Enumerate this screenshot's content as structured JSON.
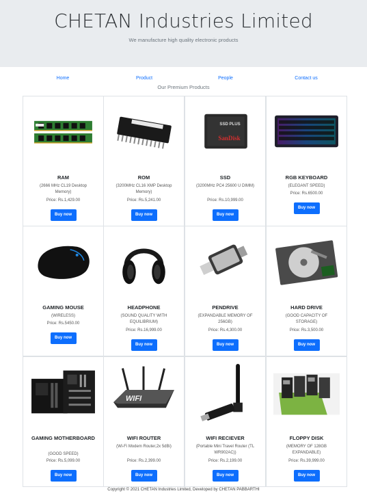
{
  "header": {
    "title": "CHETAN Industries Limited",
    "tagline": "We manufacture high quality electronic products"
  },
  "nav": [
    {
      "label": "Home"
    },
    {
      "label": "Product"
    },
    {
      "label": "People"
    },
    {
      "label": "Contact us"
    }
  ],
  "section_title": "Our Premium Products",
  "products": [
    {
      "name": "RAM",
      "desc": "(2666 MHz CL19 Desktop Memory)",
      "price": "Price: Rs.1,429.00",
      "button": "Buy now",
      "icon": "ram-icon"
    },
    {
      "name": "ROM",
      "desc": "(3200MHz CL16 XMP Desktop Memory)",
      "price": "Price: Rs.5,241.00",
      "button": "Buy now",
      "icon": "rom-chip-icon"
    },
    {
      "name": "SSD",
      "desc": "(3200MHz PC4 25600 U DIMM)",
      "price": "Price: Rs.10,999.00",
      "button": "Buy now",
      "icon": "ssd-icon"
    },
    {
      "name": "RGB KEYBOARD",
      "desc": "(ELEGANT SPEED)",
      "price": "Price: Rs.6500.00",
      "button": "Buy now",
      "icon": "keyboard-icon"
    },
    {
      "name": "GAMING MOUSE",
      "desc": "(WIRELESS)",
      "price": "Price: Rs.5450.00",
      "button": "Buy now",
      "icon": "mouse-icon"
    },
    {
      "name": "HEADPHONE",
      "desc": "(SOUND QUALITY WITH EQUILIBRIUM)",
      "price": "Price: Rs.16,999.00",
      "button": "Buy now",
      "icon": "headphone-icon"
    },
    {
      "name": "PENDRIVE",
      "desc": "(EXPANDABLE MEMORY OF 256GB)",
      "price": "Price: Rs.4,300.00",
      "button": "Buy now",
      "icon": "pendrive-icon"
    },
    {
      "name": "HARD DRIVE",
      "desc": "(GOOD CAPACITY OF STORAGE)",
      "price": "Price: Rs.3,500.00",
      "button": "Buy now",
      "icon": "hard-drive-icon"
    },
    {
      "name": "GAMING MOTHERBOARD",
      "desc": "(GOOD SPEED)",
      "price": "Price: Rs.5,099.00",
      "button": "Buy now",
      "icon": "motherboard-icon"
    },
    {
      "name": "WIFI ROUTER",
      "desc": "(Wi-Fi Modem Router,2x 5dBi)",
      "price": "Price: Rs.2,399.00",
      "button": "Buy now",
      "icon": "router-icon"
    },
    {
      "name": "WIFI RECIEVER",
      "desc": "(Portable Mini Travel Router (TL WR902AC))",
      "price": "Price: Rs.2,199.00",
      "button": "Buy now",
      "icon": "wifi-receiver-icon"
    },
    {
      "name": "FLOPPY DISK",
      "desc": "(MEMORY OF 128GB EXPANDABLE)",
      "price": "Price: Rs.39,999.00",
      "button": "Buy now",
      "icon": "floppy-disk-icon"
    }
  ],
  "footer": "Copyright © 2021 CHETAN Industries Limited, Developed by CHETAN PABBARTHI",
  "colors": {
    "accent": "#0d6efd",
    "header_bg": "#e9ecef"
  }
}
